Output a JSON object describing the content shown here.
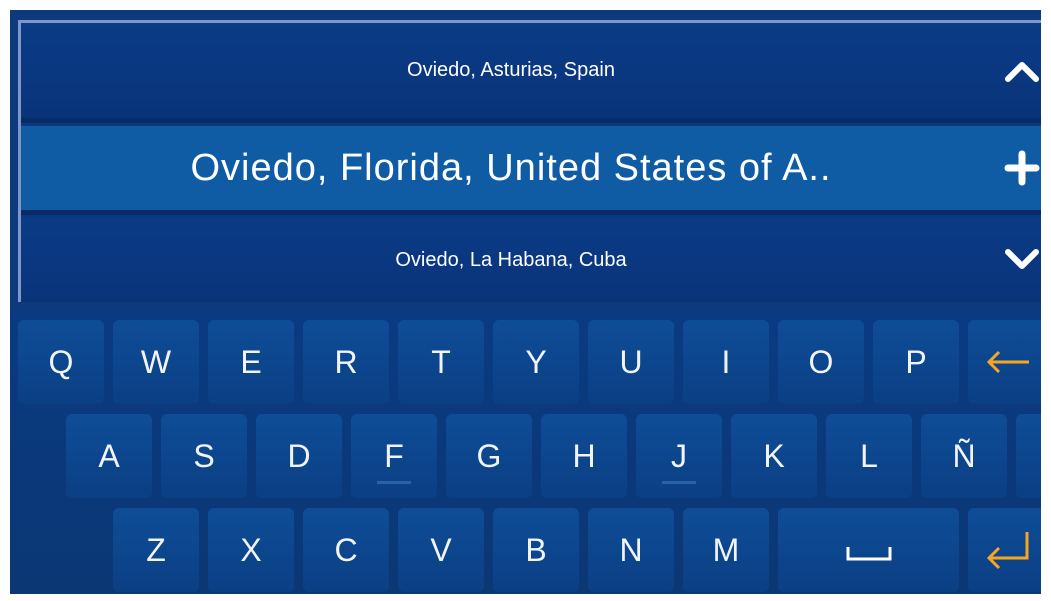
{
  "results": {
    "previous": "Oviedo, Asturias, Spain",
    "selected": "Oviedo, Florida, United States of A..",
    "next": "Oviedo, La Habana, Cuba"
  },
  "icons": {
    "scroll_up": "chevron-up-icon",
    "add": "plus-icon",
    "scroll_down": "chevron-down-icon",
    "backspace": "backspace-arrow-icon",
    "enter": "enter-return-icon",
    "space": "space-bar-icon"
  },
  "colors": {
    "background": "#0c3a7c",
    "selected_row": "#0f5ca5",
    "key": "#0e4d97",
    "accent": "#f5a623",
    "border": "#7e97c6"
  },
  "keyboard": {
    "row1": [
      "Q",
      "W",
      "E",
      "R",
      "T",
      "Y",
      "U",
      "I",
      "O",
      "P"
    ],
    "row2": [
      "A",
      "S",
      "D",
      "F",
      "G",
      "H",
      "J",
      "K",
      "L",
      "Ñ"
    ],
    "row3": [
      "Z",
      "X",
      "C",
      "V",
      "B",
      "N",
      "M"
    ]
  }
}
